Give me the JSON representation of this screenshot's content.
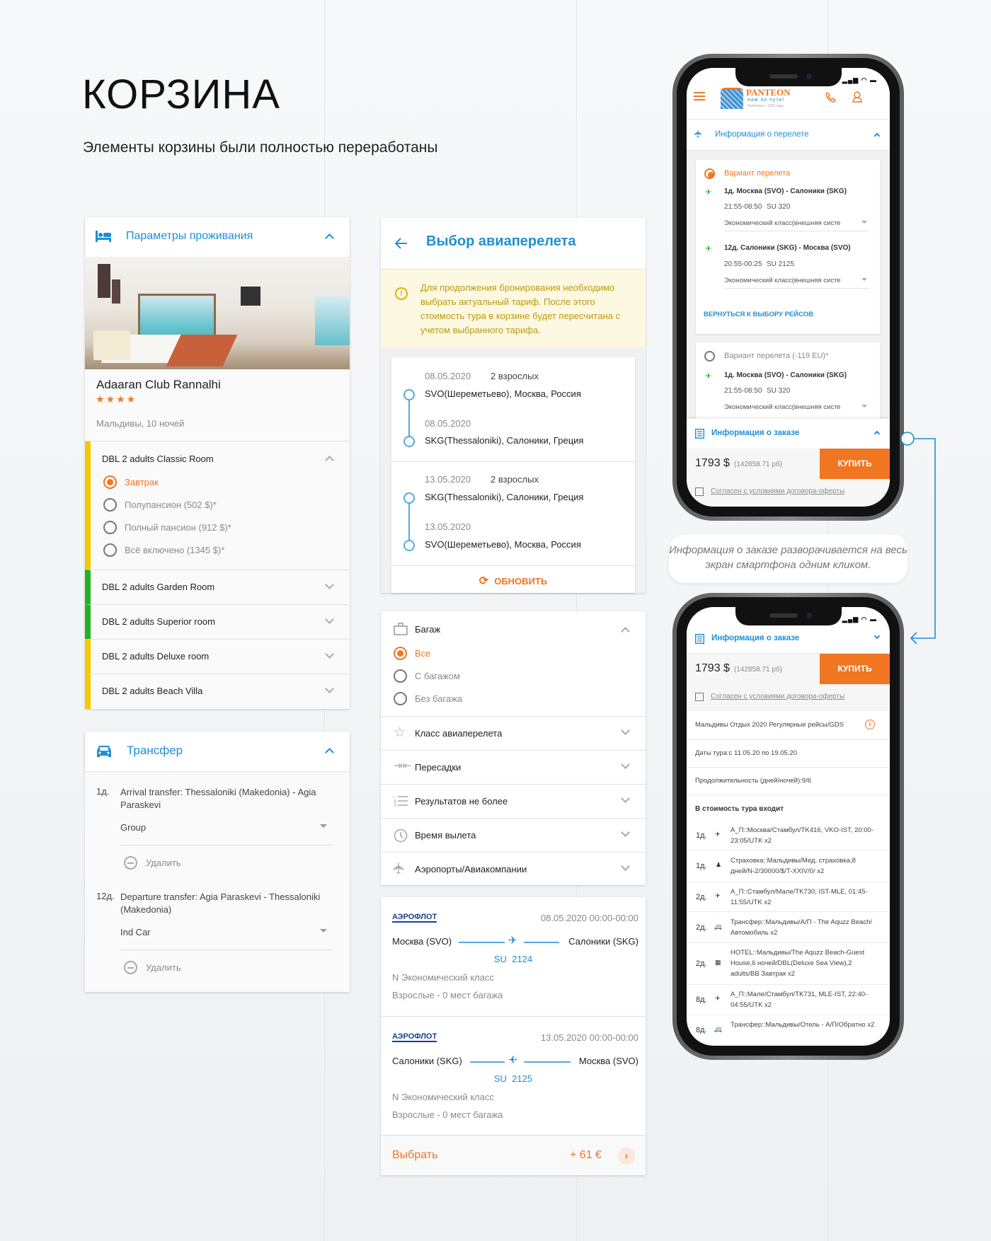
{
  "page": {
    "title": "КОРЗИНА",
    "subtitle": "Элементы корзины были полностью переработаны"
  },
  "colors": {
    "accent": "#1e8fd5",
    "orange": "#f07622",
    "yellow": "#f5c800",
    "green": "#22b322"
  },
  "accommodation": {
    "header": "Параметры проживания",
    "hotel_name": "Adaaran Club Rannalhi",
    "stars": 4,
    "stars_text": "★★★★",
    "location": "Мальдивы, 10 ночей",
    "rooms": [
      {
        "name": "DBL 2 adults Classic Room",
        "status": "yellow",
        "expanded": true,
        "meals": [
          {
            "label": "Завтрак",
            "selected": true
          },
          {
            "label": "Полупансион (502 $)*"
          },
          {
            "label": "Полный пансион (912 $)*"
          },
          {
            "label": "Всё включено (1345 $)*"
          }
        ]
      },
      {
        "name": "DBL 2 adults Garden Room",
        "status": "green"
      },
      {
        "name": "DBL 2 adults Superior room",
        "status": "green"
      },
      {
        "name": "DBL 2 adults Deluxe room",
        "status": "yellow"
      },
      {
        "name": "DBL 2 adults Beach Villa",
        "status": "yellow"
      }
    ]
  },
  "transfer": {
    "header": "Трансфер",
    "items": [
      {
        "day": "1д.",
        "title": "Arrival transfer: Thessaloniki (Makedonia) - Agia Paraskevi",
        "type": "Group",
        "remove": "Удалить"
      },
      {
        "day": "12д.",
        "title": "Departure transfer: Agia Paraskevi - Thessaloniki (Makedonia)",
        "type": "Ind Car",
        "remove": "Удалить"
      }
    ]
  },
  "flight_select": {
    "title": "Выбор авиаперелета",
    "warning": "Для продолжения бронирования необходимо выбрать актуальный тариф. После этого стоимость тура в корзине будет пересчитана с учетом выбранного тарифа.",
    "routes": [
      {
        "date1": "08.05.2020",
        "pax": "2 взрослых",
        "from": "SVO(Шереметьево), Москва, Россия",
        "date2": "08.05.2020",
        "to": "SKG(Thessaloniki), Салоники, Греция"
      },
      {
        "date1": "13.05.2020",
        "pax": "2 взрослых",
        "from": "SKG(Thessaloniki), Салоники, Греция",
        "date2": "13.05.2020",
        "to": "SVO(Шереметьево), Москва, Россия"
      }
    ],
    "refresh": "ОБНОВИТЬ",
    "baggage": {
      "label": "Багаж",
      "options": [
        {
          "label": "Все",
          "selected": true
        },
        {
          "label": "С багажом"
        },
        {
          "label": "Без багажа"
        }
      ]
    },
    "filters": [
      "Класс авиаперелета",
      "Пересадки",
      "Результатов не более",
      "Время вылета",
      "Аэропорты/Авиакомпании"
    ],
    "results": [
      {
        "airline": "АЭРОФЛОТ",
        "datetime": "08.05.2020 00:00-00:00",
        "from": "Москва (SVO)",
        "to": "Салоники (SKG)",
        "flight": "SU  2124",
        "class": "N Экономический класс",
        "baggage": "Взрослые - 0 мест багажа"
      },
      {
        "airline": "АЭРОФЛОТ",
        "datetime": "13.05.2020 00:00-00:00",
        "from": "Салоники (SKG)",
        "to": "Москва (SVO)",
        "flight": "SU  2125",
        "class": "N Экономический класс",
        "baggage": "Взрослые - 0 мест багажа"
      }
    ],
    "select_label": "Выбрать",
    "price_diff": "+ 61 €"
  },
  "phone1": {
    "logo": {
      "brand": "PANTEON",
      "tagline": "нам по пути!",
      "since": "Работаем с 1992 года"
    },
    "flight_info": "Информация о перелете",
    "variants": [
      {
        "label": "Вариант перелета",
        "selected": true,
        "legs": [
          {
            "title": "1д. Москва (SVO) - Салоники (SKG)",
            "time": "21:55-08:50",
            "flight": "SU 320",
            "class": "Экономический класс(внешняя систе"
          },
          {
            "title": "12д. Салоники (SKG) - Москва (SVO)",
            "time": "20:55-00:25",
            "flight": "SU 2125",
            "class": "Экономический класс(внешняя систе"
          }
        ]
      },
      {
        "label": "Вариант перелета  (-119 EU)*",
        "legs": [
          {
            "title": "1д. Москва (SVO) - Салоники (SKG)",
            "time": "21:55-08:50",
            "flight": "SU 320",
            "class": "Экономический класс(внешняя систе"
          }
        ]
      }
    ],
    "back_link": "ВЕРНУТЬСЯ К ВЫБОРУ РЕЙСОВ"
  },
  "order": {
    "header": "Информация о заказе",
    "price": "1793 $",
    "price_rub": "(142858.71 рб)",
    "buy": "КУПИТЬ",
    "agree": "Согласен с условиями договора-оферты",
    "tour": "Мальдивы Отдых 2020 Регулярные рейсы/GDS",
    "dates": "Даты тура:с 11.05.20 по 19.05.20",
    "duration": "Продолжительность (дней/ночей):9/6",
    "includes_title": "В стоимость тура входит",
    "includes": [
      {
        "day": "1д.",
        "icon": "plane",
        "text": "А_П::Москва/Стамбул/TK416, VKO-IST, 20:00-23:05/UTK x2"
      },
      {
        "day": "1д.",
        "icon": "insurance",
        "text": "Страховка::Мальдивы/Мед. страховка,8 дней/N-2/30000/$/T-XXIV/0/ x2"
      },
      {
        "day": "2д.",
        "icon": "plane",
        "text": "А_П::Стамбул/Мале/TK730, IST-MLE, 01:45-11:55/UTK x2"
      },
      {
        "day": "2д.",
        "icon": "bus",
        "text": "Трансфер::Мальдивы/А/П - The Aquzz Beach/Автомобиль x2"
      },
      {
        "day": "2д.",
        "icon": "hotel",
        "text": "HOTEL::Мальдивы/The Aquzz Beach-Guest House,6 ночей/DBL(Deluxe Sea View),2 adults/BB Завтрак x2"
      },
      {
        "day": "8д.",
        "icon": "plane",
        "text": "А_П::Мале/Стамбул/TK731, MLE-IST, 22:40-04:55/UTK x2"
      },
      {
        "day": "8д.",
        "icon": "bus",
        "text": "Трансфер::Мальдивы/Отель - А/П/Обратно x2"
      }
    ]
  },
  "callout": "Информация о заказе разворачивается на весь экран смартфона одним кликом."
}
